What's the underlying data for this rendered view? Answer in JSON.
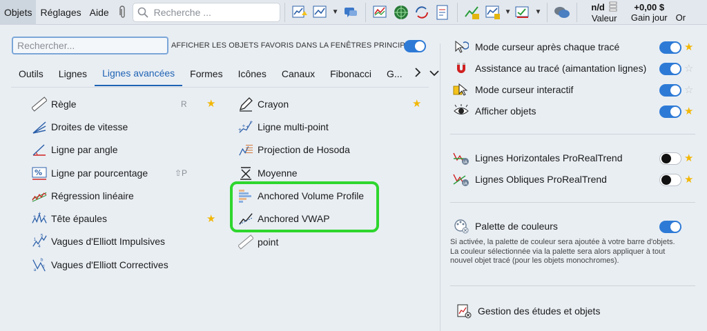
{
  "menubar": {
    "objets": "Objets",
    "reglages": "Réglages",
    "aide": "Aide",
    "search_placeholder": "Recherche ..."
  },
  "stats": {
    "valeur_top": "n/d",
    "valeur_label": "Valeur",
    "gain_top": "+0,00 $",
    "gain_label": "Gain jour",
    "or_label": "Or"
  },
  "panel": {
    "search_placeholder": "Rechercher...",
    "favorites_label": "AFFICHER LES OBJETS FAVORIS DANS LA FENÊTRES PRINCIPALE",
    "favorites_toggle": "on"
  },
  "tabs": [
    "Outils",
    "Lignes",
    "Lignes avancées",
    "Formes",
    "Icônes",
    "Canaux",
    "Fibonacci",
    "G..."
  ],
  "active_tab": "Lignes avancées",
  "tools_left": [
    {
      "label": "Règle",
      "shortcut": "R",
      "favorite": true,
      "icon": "ruler-icon"
    },
    {
      "label": "Droites de vitesse",
      "icon": "speed-lines-icon"
    },
    {
      "label": "Ligne par angle",
      "icon": "angle-line-icon"
    },
    {
      "label": "Ligne par pourcentage",
      "shortcut": "⇧P",
      "icon": "percent-line-icon"
    },
    {
      "label": "Régression linéaire",
      "icon": "regression-icon"
    },
    {
      "label": "Tête épaules",
      "favorite": true,
      "icon": "head-shoulders-icon"
    },
    {
      "label": "Vagues d'Elliott Impulsives",
      "icon": "elliott-impulse-icon"
    },
    {
      "label": "Vagues d'Elliott Correctives",
      "icon": "elliott-corrective-icon"
    }
  ],
  "tools_right": [
    {
      "label": "Crayon",
      "favorite": true,
      "icon": "pencil-icon"
    },
    {
      "label": "Ligne multi-point",
      "icon": "multipoint-icon"
    },
    {
      "label": "Projection de Hosoda",
      "icon": "hosoda-icon"
    },
    {
      "label": "Moyenne",
      "icon": "average-icon"
    },
    {
      "label": "Anchored Volume Profile",
      "icon": "volume-profile-icon"
    },
    {
      "label": "Anchored VWAP",
      "icon": "vwap-icon"
    },
    {
      "label": "point",
      "icon": "point-ruler-icon"
    }
  ],
  "options": [
    {
      "label": "Mode curseur après chaque tracé",
      "toggle": "on",
      "favorite": true
    },
    {
      "label": "Assistance au tracé (aimantation lignes)",
      "toggle": "on",
      "favorite": false
    },
    {
      "label": "Mode curseur interactif",
      "toggle": "on",
      "favorite": false
    },
    {
      "label": "Afficher objets",
      "toggle": "on",
      "favorite": true
    },
    {
      "label": "Lignes Horizontales ProRealTrend",
      "toggle": "off",
      "favorite": true
    },
    {
      "label": "Lignes Obliques ProRealTrend",
      "toggle": "off",
      "favorite": true
    },
    {
      "label": "Palette de couleurs",
      "toggle": "on"
    }
  ],
  "palette_description": "Si activée, la palette de couleur sera ajoutée à votre barre d'objets. La couleur sélectionnée via la palette sera alors appliquer à tout nouvel objet tracé (pour les objets monochromes).",
  "gestion_label": "Gestion des études et objets",
  "colors": {
    "accent": "#1f63b4",
    "toggle_on": "#2d7ad6",
    "highlight": "#2ed62e",
    "star": "#f2b705"
  }
}
